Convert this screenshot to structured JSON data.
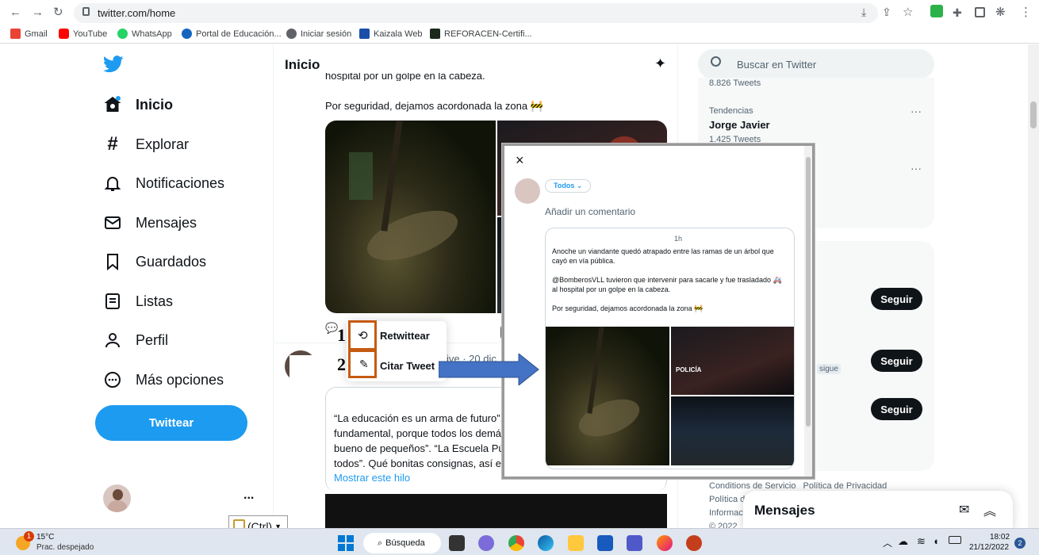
{
  "browser": {
    "url": "twitter.com/home",
    "bookmarks": [
      {
        "label": "Gmail",
        "color": "#ea4335"
      },
      {
        "label": "YouTube",
        "color": "#ff0000"
      },
      {
        "label": "WhatsApp",
        "color": "#25d366"
      },
      {
        "label": "Portal de Educación...",
        "color": "#1565c0"
      },
      {
        "label": "Iniciar sesión",
        "color": "#5f6368"
      },
      {
        "label": "Kaizala Web",
        "color": "#1a4ea8"
      },
      {
        "label": "REFORACEN-Certifi...",
        "color": "#1b2a1b"
      }
    ]
  },
  "sidebar": {
    "items": [
      {
        "label": "Inicio",
        "icon": "home-icon"
      },
      {
        "label": "Explorar",
        "icon": "hashtag-icon"
      },
      {
        "label": "Notificaciones",
        "icon": "bell-icon"
      },
      {
        "label": "Mensajes",
        "icon": "envelope-icon"
      },
      {
        "label": "Guardados",
        "icon": "bookmark-icon"
      },
      {
        "label": "Listas",
        "icon": "list-icon"
      },
      {
        "label": "Perfil",
        "icon": "person-icon"
      },
      {
        "label": "Más opciones",
        "icon": "more-circle-icon"
      }
    ],
    "tweet_button": "Twittear",
    "account_more": "..."
  },
  "timeline": {
    "title": "Inicio",
    "tweet_text_partial": "hospital por un golpe en la cabeza.",
    "tweet_text_line2": "Por seguridad, dejamos acordonada la zona 🚧",
    "retweet_menu": {
      "retweet": "Retwittear",
      "quote": "Citar Tweet"
    },
    "second_tweet_meta": "ive · 20 dic",
    "quoted_lines": [
      "“La educación es un arma de futuro”.",
      "fundamental, porque todos los demás",
      "bueno de pequeños”. “La Escuela Pú",
      "todos”. Qué bonitas consignas, así er"
    ],
    "show_thread": "Mostrar este hilo"
  },
  "right": {
    "search_placeholder": "Buscar en Twitter",
    "tweets_count_1": "8.826 Tweets",
    "trend_label": "Tendencias",
    "trend_name": "Jorge Javier",
    "trend_count": "1.425 Tweets",
    "follow_label": "Seguir",
    "follows_you": "sigue",
    "footer": {
      "terms": "Conditions de Servicio",
      "privacy": "Política de Privacidad",
      "line2": "Política d",
      "line3": "Informac",
      "line4": "© 2022"
    },
    "messages_title": "Mensajes"
  },
  "modal": {
    "close": "×",
    "audience": "Todos",
    "comment_placeholder": "Añadir un comentario",
    "quoted_time": "1h",
    "quoted_text_1": "Anoche un viandante quedó atrapado entre las ramas de un árbol que cayó en vía pública.",
    "quoted_text_2": "@BomberosVLL tuvieron que intervenir para sacarle y fue trasladado 🚑 al hospital por un golpe en la cabeza.",
    "quoted_text_3": "Por seguridad, dejamos acordonada la zona 🚧",
    "police_label": "POLICÍA"
  },
  "annotations": {
    "one": "1",
    "two": "2"
  },
  "paste": {
    "label": "(Ctrl)"
  },
  "taskbar": {
    "weather_temp": "15°C",
    "weather_desc": "Prac. despejado",
    "weather_badge": "1",
    "search": "Búsqueda",
    "time": "18:02",
    "date": "21/12/2022",
    "notif_count": "2"
  },
  "colors": {
    "twitter_blue": "#1d9bf0",
    "annotation_orange": "#c55a11",
    "arrow_blue": "#4472c4"
  }
}
